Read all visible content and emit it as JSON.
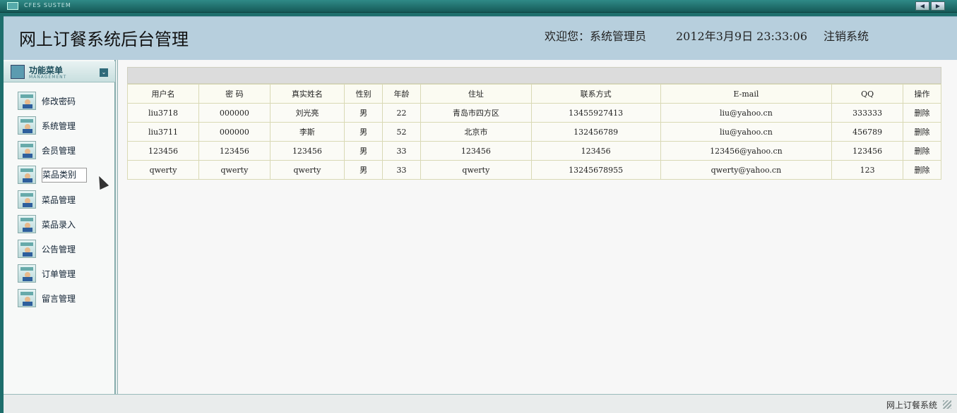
{
  "window": {
    "system_label": "CFES SUSTEM",
    "nav_prev": "◀",
    "nav_next": "▶"
  },
  "header": {
    "title": "网上订餐系统后台管理",
    "welcome": "欢迎您：系统管理员",
    "datetime": "2012年3月9日  23:33:06",
    "logout": "注销系统"
  },
  "sidebar": {
    "title": "功能菜单",
    "subtitle": "MANAGEMENT",
    "toggle": "⌄",
    "items": [
      {
        "label": "修改密码"
      },
      {
        "label": "系统管理"
      },
      {
        "label": "会员管理"
      },
      {
        "label": "菜品类别"
      },
      {
        "label": "菜品管理"
      },
      {
        "label": "菜品录入"
      },
      {
        "label": "公告管理"
      },
      {
        "label": "订单管理"
      },
      {
        "label": "留言管理"
      }
    ]
  },
  "table": {
    "headers": [
      "用户名",
      "密  码",
      "真实姓名",
      "性别",
      "年龄",
      "住址",
      "联系方式",
      "E-mail",
      "QQ",
      "操作"
    ],
    "rows": [
      [
        "liu3718",
        "000000",
        "刘光亮",
        "男",
        "22",
        "青岛市四方区",
        "13455927413",
        "liu@yahoo.cn",
        "333333",
        "删除"
      ],
      [
        "liu3711",
        "000000",
        "李斯",
        "男",
        "52",
        "北京市",
        "132456789",
        "liu@yahoo.cn",
        "456789",
        "删除"
      ],
      [
        "123456",
        "123456",
        "123456",
        "男",
        "33",
        "123456",
        "123456",
        "123456@yahoo.cn",
        "123456",
        "删除"
      ],
      [
        "qwerty",
        "qwerty",
        "qwerty",
        "男",
        "33",
        "qwerty",
        "13245678955",
        "qwerty@yahoo.cn",
        "123",
        "删除"
      ]
    ]
  },
  "statusbar": {
    "text": "网上订餐系统"
  }
}
